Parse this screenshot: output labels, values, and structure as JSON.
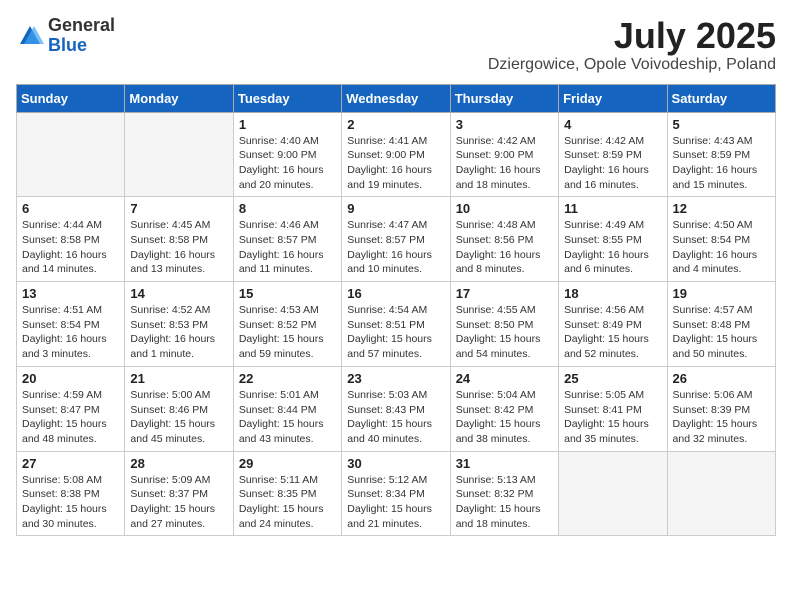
{
  "header": {
    "logo_general": "General",
    "logo_blue": "Blue",
    "title": "July 2025",
    "subtitle": "Dziergowice, Opole Voivodeship, Poland"
  },
  "weekdays": [
    "Sunday",
    "Monday",
    "Tuesday",
    "Wednesday",
    "Thursday",
    "Friday",
    "Saturday"
  ],
  "weeks": [
    [
      {
        "day": "",
        "text": ""
      },
      {
        "day": "",
        "text": ""
      },
      {
        "day": "1",
        "text": "Sunrise: 4:40 AM\nSunset: 9:00 PM\nDaylight: 16 hours and 20 minutes."
      },
      {
        "day": "2",
        "text": "Sunrise: 4:41 AM\nSunset: 9:00 PM\nDaylight: 16 hours and 19 minutes."
      },
      {
        "day": "3",
        "text": "Sunrise: 4:42 AM\nSunset: 9:00 PM\nDaylight: 16 hours and 18 minutes."
      },
      {
        "day": "4",
        "text": "Sunrise: 4:42 AM\nSunset: 8:59 PM\nDaylight: 16 hours and 16 minutes."
      },
      {
        "day": "5",
        "text": "Sunrise: 4:43 AM\nSunset: 8:59 PM\nDaylight: 16 hours and 15 minutes."
      }
    ],
    [
      {
        "day": "6",
        "text": "Sunrise: 4:44 AM\nSunset: 8:58 PM\nDaylight: 16 hours and 14 minutes."
      },
      {
        "day": "7",
        "text": "Sunrise: 4:45 AM\nSunset: 8:58 PM\nDaylight: 16 hours and 13 minutes."
      },
      {
        "day": "8",
        "text": "Sunrise: 4:46 AM\nSunset: 8:57 PM\nDaylight: 16 hours and 11 minutes."
      },
      {
        "day": "9",
        "text": "Sunrise: 4:47 AM\nSunset: 8:57 PM\nDaylight: 16 hours and 10 minutes."
      },
      {
        "day": "10",
        "text": "Sunrise: 4:48 AM\nSunset: 8:56 PM\nDaylight: 16 hours and 8 minutes."
      },
      {
        "day": "11",
        "text": "Sunrise: 4:49 AM\nSunset: 8:55 PM\nDaylight: 16 hours and 6 minutes."
      },
      {
        "day": "12",
        "text": "Sunrise: 4:50 AM\nSunset: 8:54 PM\nDaylight: 16 hours and 4 minutes."
      }
    ],
    [
      {
        "day": "13",
        "text": "Sunrise: 4:51 AM\nSunset: 8:54 PM\nDaylight: 16 hours and 3 minutes."
      },
      {
        "day": "14",
        "text": "Sunrise: 4:52 AM\nSunset: 8:53 PM\nDaylight: 16 hours and 1 minute."
      },
      {
        "day": "15",
        "text": "Sunrise: 4:53 AM\nSunset: 8:52 PM\nDaylight: 15 hours and 59 minutes."
      },
      {
        "day": "16",
        "text": "Sunrise: 4:54 AM\nSunset: 8:51 PM\nDaylight: 15 hours and 57 minutes."
      },
      {
        "day": "17",
        "text": "Sunrise: 4:55 AM\nSunset: 8:50 PM\nDaylight: 15 hours and 54 minutes."
      },
      {
        "day": "18",
        "text": "Sunrise: 4:56 AM\nSunset: 8:49 PM\nDaylight: 15 hours and 52 minutes."
      },
      {
        "day": "19",
        "text": "Sunrise: 4:57 AM\nSunset: 8:48 PM\nDaylight: 15 hours and 50 minutes."
      }
    ],
    [
      {
        "day": "20",
        "text": "Sunrise: 4:59 AM\nSunset: 8:47 PM\nDaylight: 15 hours and 48 minutes."
      },
      {
        "day": "21",
        "text": "Sunrise: 5:00 AM\nSunset: 8:46 PM\nDaylight: 15 hours and 45 minutes."
      },
      {
        "day": "22",
        "text": "Sunrise: 5:01 AM\nSunset: 8:44 PM\nDaylight: 15 hours and 43 minutes."
      },
      {
        "day": "23",
        "text": "Sunrise: 5:03 AM\nSunset: 8:43 PM\nDaylight: 15 hours and 40 minutes."
      },
      {
        "day": "24",
        "text": "Sunrise: 5:04 AM\nSunset: 8:42 PM\nDaylight: 15 hours and 38 minutes."
      },
      {
        "day": "25",
        "text": "Sunrise: 5:05 AM\nSunset: 8:41 PM\nDaylight: 15 hours and 35 minutes."
      },
      {
        "day": "26",
        "text": "Sunrise: 5:06 AM\nSunset: 8:39 PM\nDaylight: 15 hours and 32 minutes."
      }
    ],
    [
      {
        "day": "27",
        "text": "Sunrise: 5:08 AM\nSunset: 8:38 PM\nDaylight: 15 hours and 30 minutes."
      },
      {
        "day": "28",
        "text": "Sunrise: 5:09 AM\nSunset: 8:37 PM\nDaylight: 15 hours and 27 minutes."
      },
      {
        "day": "29",
        "text": "Sunrise: 5:11 AM\nSunset: 8:35 PM\nDaylight: 15 hours and 24 minutes."
      },
      {
        "day": "30",
        "text": "Sunrise: 5:12 AM\nSunset: 8:34 PM\nDaylight: 15 hours and 21 minutes."
      },
      {
        "day": "31",
        "text": "Sunrise: 5:13 AM\nSunset: 8:32 PM\nDaylight: 15 hours and 18 minutes."
      },
      {
        "day": "",
        "text": ""
      },
      {
        "day": "",
        "text": ""
      }
    ]
  ]
}
